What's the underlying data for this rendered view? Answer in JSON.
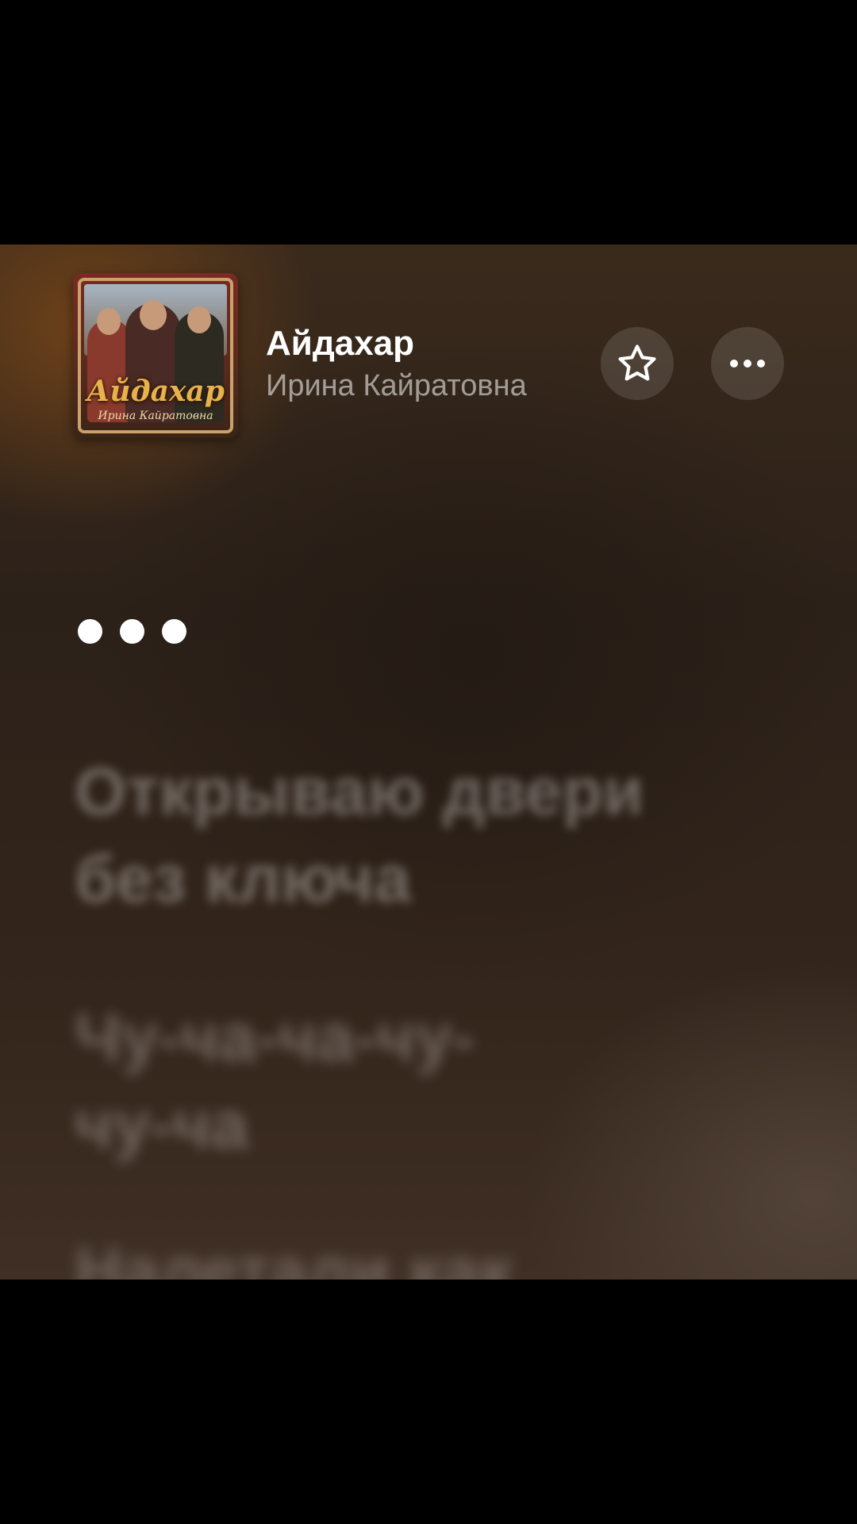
{
  "header": {
    "artwork": {
      "title": "Айдахар",
      "subtitle": "Ирина Кайратовна"
    },
    "track_title": "Айдахар",
    "artist": "Ирина Кайратовна",
    "favorite_icon": "star-icon",
    "more_icon": "ellipsis-icon"
  },
  "lyrics": {
    "indicator_icon": "ellipsis-dots",
    "lines": [
      {
        "line1": "Открываю двери",
        "line2": "без ключа"
      },
      {
        "line1": "Чу-ча-ча-чу-",
        "line2": "чу-ча"
      },
      {
        "line1": "Налетали как"
      }
    ]
  },
  "colors": {
    "background_top": "#3a2a1c",
    "background_warm_glow": "#784619",
    "lyric_inactive": "rgba(255,255,255,0.32)",
    "title": "#ffffff",
    "artist": "rgba(255,255,255,0.55)"
  }
}
